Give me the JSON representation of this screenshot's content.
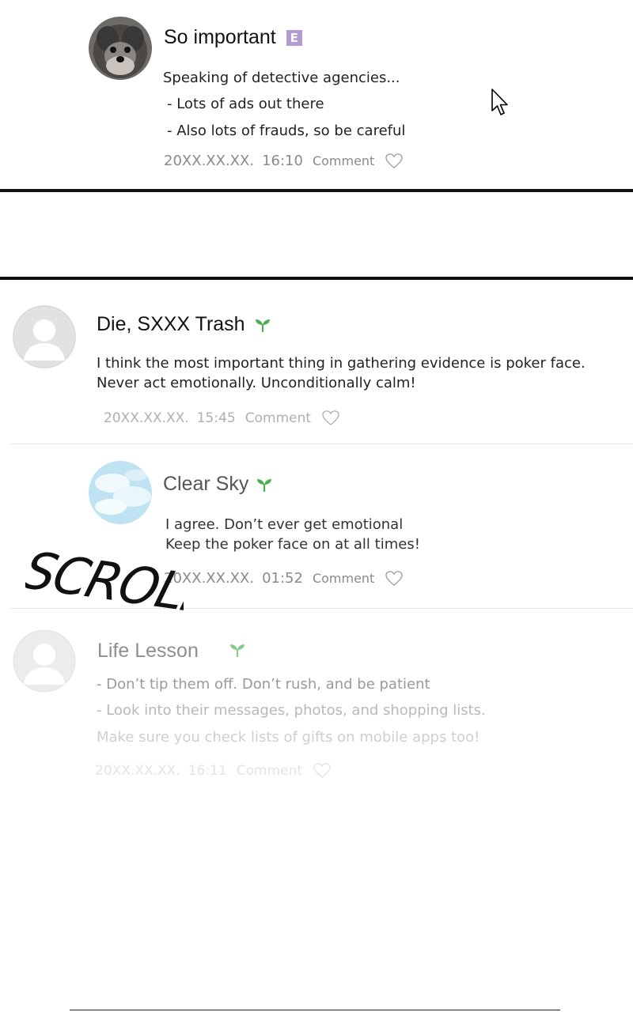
{
  "posts": [
    {
      "author": "So important",
      "badge": "E",
      "lines": [
        "Speaking of detective agencies...",
        "- Lots of ads out there",
        "- Also lots of frauds, so be careful"
      ],
      "date": "20XX.XX.XX.",
      "time": "16:10",
      "comment_label": "Comment"
    },
    {
      "author": "Die, SXXX Trash",
      "badge_icon": "sprout-icon",
      "lines": [
        "I think the most important thing in gathering evidence is poker face.",
        "Never act emotionally. Unconditionally calm!"
      ],
      "date": "20XX.XX.XX.",
      "time": "15:45",
      "comment_label": "Comment"
    },
    {
      "author": "Clear Sky",
      "badge_icon": "sprout-icon",
      "lines": [
        "I agree. Don’t ever get emotional",
        "Keep the poker face on at all times!"
      ],
      "date": "20XX.XX.XX.",
      "time": "01:52",
      "comment_label": "Comment"
    },
    {
      "author": "Life Lesson",
      "badge_icon": "sprout-icon",
      "lines": [
        "- Don’t tip them off. Don’t rush, and be patient",
        "- Look into their messages, photos, and shopping lists.",
        "Make sure you check lists of gifts on mobile apps too!"
      ],
      "date": "20XX.XX.XX.",
      "time": "16:11",
      "comment_label": "Comment"
    }
  ],
  "overlay_text": "SCROLL",
  "colors": {
    "badge_purple": "#b39dd0",
    "sprout_green": "#4caf50",
    "meta_gray": "#8a8a8a",
    "faded_gray": "#c8c8c8"
  }
}
